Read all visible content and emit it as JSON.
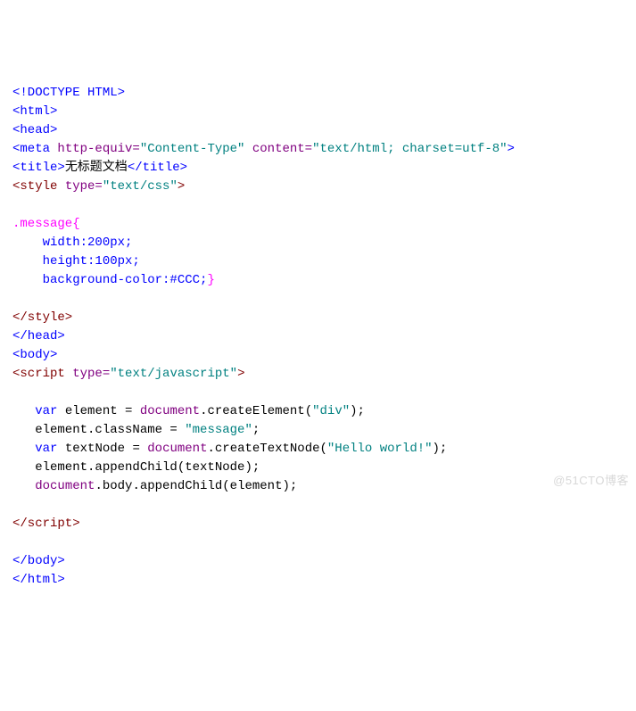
{
  "lines": [
    {
      "segments": [
        {
          "cls": "t-blue",
          "text": "<!DOCTYPE HTML>"
        }
      ]
    },
    {
      "segments": [
        {
          "cls": "t-blue",
          "text": "<html>"
        }
      ]
    },
    {
      "segments": [
        {
          "cls": "t-blue",
          "text": "<head>"
        }
      ]
    },
    {
      "segments": [
        {
          "cls": "t-blue",
          "text": "<meta"
        },
        {
          "cls": "",
          "text": " "
        },
        {
          "cls": "t-purple",
          "text": "http-equiv="
        },
        {
          "cls": "t-teal",
          "text": "\"Content-Type\""
        },
        {
          "cls": "",
          "text": " "
        },
        {
          "cls": "t-purple",
          "text": "content="
        },
        {
          "cls": "t-teal",
          "text": "\"text/html; charset=utf-8\""
        },
        {
          "cls": "t-blue",
          "text": ">"
        }
      ]
    },
    {
      "segments": [
        {
          "cls": "t-blue",
          "text": "<title>"
        },
        {
          "cls": "",
          "text": "无标题文档"
        },
        {
          "cls": "t-blue",
          "text": "</title>"
        }
      ]
    },
    {
      "segments": [
        {
          "cls": "t-maroon",
          "text": "<style "
        },
        {
          "cls": "t-purple",
          "text": "type="
        },
        {
          "cls": "t-teal",
          "text": "\"text/css\""
        },
        {
          "cls": "t-maroon",
          "text": ">"
        }
      ]
    },
    {
      "segments": [
        {
          "cls": "",
          "text": ""
        }
      ]
    },
    {
      "segments": [
        {
          "cls": "t-pink",
          "text": ".message{"
        }
      ]
    },
    {
      "segments": [
        {
          "cls": "",
          "text": "    "
        },
        {
          "cls": "t-blue",
          "text": "width:200px;"
        }
      ]
    },
    {
      "segments": [
        {
          "cls": "",
          "text": "    "
        },
        {
          "cls": "t-blue",
          "text": "height:100px;"
        }
      ]
    },
    {
      "segments": [
        {
          "cls": "",
          "text": "    "
        },
        {
          "cls": "t-blue",
          "text": "background-color:#CCC;"
        },
        {
          "cls": "t-pink",
          "text": "}"
        }
      ]
    },
    {
      "segments": [
        {
          "cls": "",
          "text": ""
        }
      ]
    },
    {
      "segments": [
        {
          "cls": "t-maroon",
          "text": "</style>"
        }
      ]
    },
    {
      "segments": [
        {
          "cls": "t-blue",
          "text": "</head>"
        }
      ]
    },
    {
      "segments": [
        {
          "cls": "t-blue",
          "text": "<body>"
        }
      ]
    },
    {
      "segments": [
        {
          "cls": "t-maroon",
          "text": "<script "
        },
        {
          "cls": "t-purple",
          "text": "type="
        },
        {
          "cls": "t-teal",
          "text": "\"text/javascript\""
        },
        {
          "cls": "t-maroon",
          "text": ">"
        }
      ]
    },
    {
      "segments": [
        {
          "cls": "",
          "text": ""
        }
      ]
    },
    {
      "segments": [
        {
          "cls": "",
          "text": "   "
        },
        {
          "cls": "t-blue",
          "text": "var"
        },
        {
          "cls": "",
          "text": " element = "
        },
        {
          "cls": "t-purple",
          "text": "document"
        },
        {
          "cls": "",
          "text": ".createElement("
        },
        {
          "cls": "t-teal",
          "text": "\"div\""
        },
        {
          "cls": "",
          "text": ");"
        }
      ]
    },
    {
      "segments": [
        {
          "cls": "",
          "text": "   element.className = "
        },
        {
          "cls": "t-teal",
          "text": "\"message\""
        },
        {
          "cls": "",
          "text": ";"
        }
      ]
    },
    {
      "segments": [
        {
          "cls": "",
          "text": "   "
        },
        {
          "cls": "t-blue",
          "text": "var"
        },
        {
          "cls": "",
          "text": " textNode = "
        },
        {
          "cls": "t-purple",
          "text": "document"
        },
        {
          "cls": "",
          "text": ".createTextNode("
        },
        {
          "cls": "t-teal",
          "text": "\"Hello world!\""
        },
        {
          "cls": "",
          "text": ");"
        }
      ]
    },
    {
      "segments": [
        {
          "cls": "",
          "text": "   element.appendChild(textNode);"
        }
      ]
    },
    {
      "segments": [
        {
          "cls": "",
          "text": "   "
        },
        {
          "cls": "t-purple",
          "text": "document"
        },
        {
          "cls": "",
          "text": ".body.appendChild(element);"
        }
      ]
    },
    {
      "segments": [
        {
          "cls": "",
          "text": ""
        }
      ]
    },
    {
      "segments": [
        {
          "cls": "t-maroon",
          "text": "</script>"
        }
      ]
    },
    {
      "segments": [
        {
          "cls": "",
          "text": ""
        }
      ]
    },
    {
      "segments": [
        {
          "cls": "t-blue",
          "text": "</body>"
        }
      ]
    },
    {
      "segments": [
        {
          "cls": "t-blue",
          "text": "</html>"
        }
      ]
    }
  ],
  "watermark": "@51CTO博客"
}
